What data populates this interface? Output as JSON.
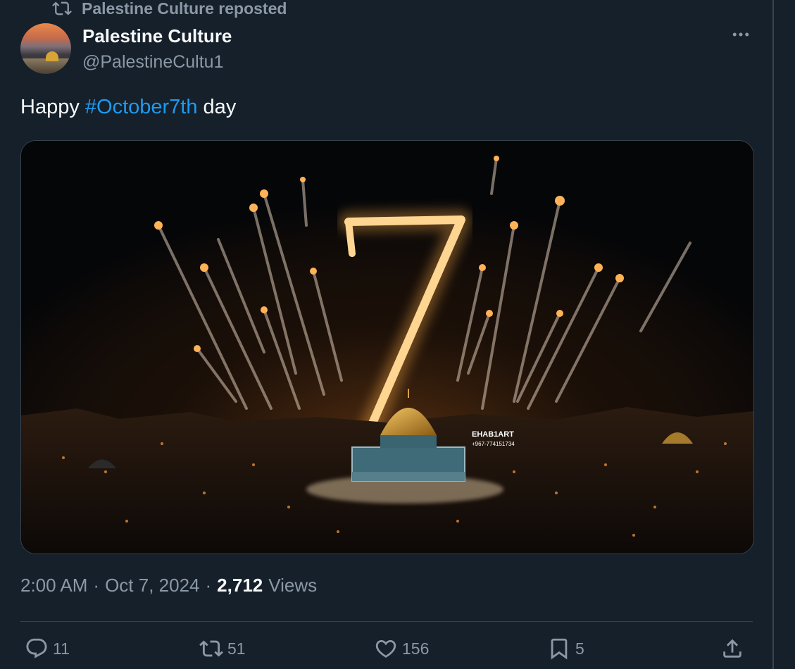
{
  "repost": {
    "text": "Palestine Culture reposted",
    "icon": "repost-icon"
  },
  "author": {
    "name": "Palestine Culture",
    "handle": "@PalestineCultu1"
  },
  "tweet": {
    "text_prefix": "Happy ",
    "hashtag": "#October7th",
    "text_suffix": " day",
    "media_image": {
      "watermark_name": "EHAB1ART",
      "watermark_phone": "+967-774151734"
    }
  },
  "meta": {
    "time": "2:00 AM",
    "date": "Oct 7, 2024",
    "views_count": "2,712",
    "views_label": "Views"
  },
  "actions": {
    "replies": "11",
    "reposts": "51",
    "likes": "156",
    "bookmarks": "5"
  },
  "colors": {
    "background": "#15202b",
    "text": "#f7f9f9",
    "muted": "#8b98a5",
    "accent": "#1d9bf0",
    "border": "#38444d"
  }
}
